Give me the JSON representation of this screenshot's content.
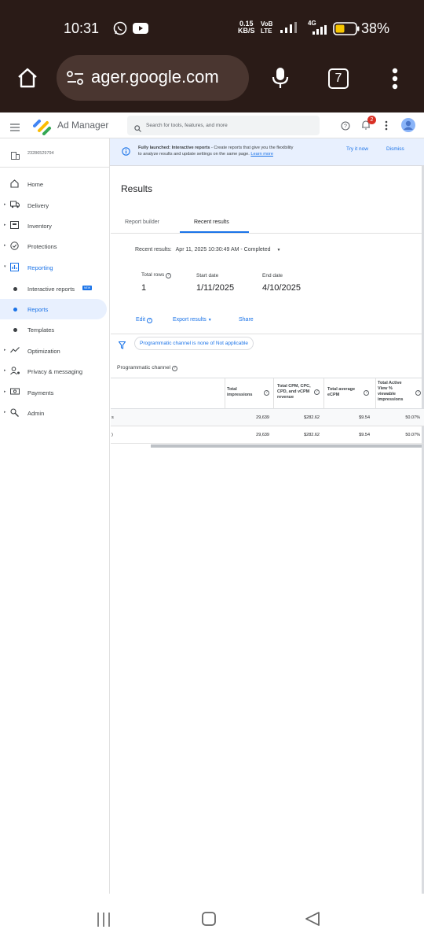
{
  "status": {
    "time": "10:31",
    "net_speed_top": "0.15",
    "net_speed_bottom": "KB/S",
    "net_type": "4G",
    "battery": "38%"
  },
  "browser": {
    "url": "ager.google.com",
    "tab_count": "7"
  },
  "app": {
    "title": "Ad Manager",
    "search_placeholder": "Search for tools, features, and more",
    "notification_count": "2",
    "network_code": "23286529794"
  },
  "banner": {
    "text_bold": "Fully launched: Interactive reports",
    "text_rest": " - Create reports that give you the flexibility",
    "text_line2": "to analyze results and update settings on the same page. ",
    "learn_more": "Learn more",
    "try_it": "Try it now",
    "dismiss": "Dismiss"
  },
  "sidebar": {
    "items": [
      {
        "label": "Home"
      },
      {
        "label": "Delivery"
      },
      {
        "label": "Inventory"
      },
      {
        "label": "Protections"
      },
      {
        "label": "Reporting"
      },
      {
        "label": "Interactive reports"
      },
      {
        "label": "Reports"
      },
      {
        "label": "Templates"
      },
      {
        "label": "Optimization"
      },
      {
        "label": "Privacy & messaging"
      },
      {
        "label": "Payments"
      },
      {
        "label": "Admin"
      }
    ],
    "new_badge": "NEW"
  },
  "main": {
    "title": "Results",
    "tabs": [
      {
        "label": "Report builder"
      },
      {
        "label": "Recent results"
      }
    ],
    "recent_results_label": "Recent results:",
    "recent_results_value": "Apr 11, 2025 10:30:49 AM - Completed",
    "summary": {
      "total_rows_label": "Total rows",
      "total_rows_value": "1",
      "start_label": "Start date",
      "start_value": "1/11/2025",
      "end_label": "End date",
      "end_value": "4/10/2025"
    },
    "actions": {
      "edit": "Edit",
      "export": "Export results",
      "share": "Share"
    },
    "filter_chip": "Programmatic channel is none of Not applicable",
    "dimension_label": "Programmatic channel",
    "table": {
      "headers": [
        "Total impressions",
        "Total CPM, CPC, CPD, and vCPM revenue",
        "Total average eCPM",
        "Total Active View % viewable impressions"
      ],
      "rows": [
        {
          "dim": "s",
          "values": [
            "29,639",
            "$282.62",
            "$9.54",
            "50.07%"
          ]
        },
        {
          "dim": ")",
          "values": [
            "29,639",
            "$282.62",
            "$9.54",
            "50.07%"
          ]
        }
      ]
    }
  },
  "colors": {
    "accent": "#1a73e8",
    "chrome_bg": "#2a1b17",
    "banner_bg": "#e8f0fe",
    "active_nav_bg": "#e8f0fe",
    "badge_red": "#d93025"
  }
}
